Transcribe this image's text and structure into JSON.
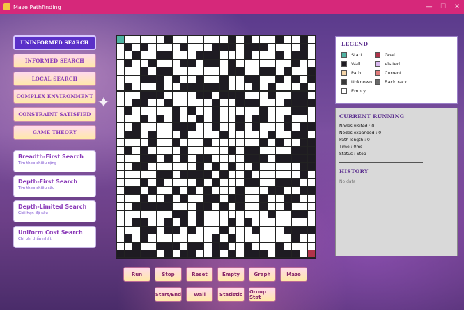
{
  "window": {
    "title": "Maze Pathfinding",
    "minimize": "—",
    "maximize": "☐",
    "close": "✕"
  },
  "categories": [
    {
      "label": "UNINFORMED SEARCH",
      "active": true
    },
    {
      "label": "INFORMED SEARCH",
      "active": false
    },
    {
      "label": "LOCAL SEARCH",
      "active": false
    },
    {
      "label": "COMPLEX ENVIRONMENT",
      "active": false
    },
    {
      "label": "CONSTRAINT SATISFIED",
      "active": false
    },
    {
      "label": "GAME THEORY",
      "active": false
    }
  ],
  "algorithms": [
    {
      "title": "Breadth-First Search",
      "subtitle": "Tìm theo chiều rộng"
    },
    {
      "title": "Depth-First Search",
      "subtitle": "Tìm theo chiều sâu"
    },
    {
      "title": "Depth-Limited Search",
      "subtitle": "Giới hạn độ sâu"
    },
    {
      "title": "Uniform Cost Search",
      "subtitle": "Chi phí thấp nhất"
    }
  ],
  "actions_row1": [
    "Run",
    "Stop",
    "Reset",
    "Empty",
    "Graph",
    "Maze"
  ],
  "actions_row2": [
    "Start/End",
    "Wall",
    "Statistic",
    "Group Stat"
  ],
  "legend": {
    "title": "LEGEND",
    "items": [
      {
        "label": "Start",
        "color": "#4fb3a3"
      },
      {
        "label": "Goal",
        "color": "#b0334a"
      },
      {
        "label": "Wall",
        "color": "#1e1b22"
      },
      {
        "label": "Visited",
        "color": "#d9b8f0"
      },
      {
        "label": "Path",
        "color": "#f5d5a8"
      },
      {
        "label": "Current",
        "color": "#e07a7a"
      },
      {
        "label": "Unknown",
        "color": "#3a3a3a"
      },
      {
        "label": "Backtrack",
        "color": "#6a6a6a"
      },
      {
        "label": "Empty",
        "color": "#ffffff"
      }
    ]
  },
  "running": {
    "title": "CURRENT RUNNING",
    "stats": [
      "Nodes visited : 0",
      "Nodes expanded : 0",
      "Path length : 0",
      "Time : 0ms",
      "Status : Stop"
    ],
    "history_title": "HISTORY",
    "history_empty": "No data"
  },
  "maze": {
    "rows": 28,
    "cols": 25,
    "colors": {
      "wall": "#1e1b22",
      "empty": "#ffffff",
      "start": "#4fb3a3",
      "goal": "#b0334a"
    },
    "cells": [
      "S.....#.......#.#...#..#.",
      ".#.#....#...###.###....#.",
      "..#..##...###...#...#.##.",
      ".#..#...##.##.#.......#..",
      "...#.##.......##..##.#..#",
      "...###.#..#..#..##..#.#.#",
      ".#...#..######...#.#...#.",
      "...###....##.###...#..##.",
      "..##..#.....#..###...####",
      ".#.....#.#..#.....#...##.",
      "...#.#.#..#.#..#.##..#...",
      "..#....###..#..#.#...#.##",
      ".##.#...#....#.....#..##.",
      "....#..#...#......#.#..##",
      ".#.#....#.....#.##....###",
      "...##.#.#.##....###.#####",
      "..##......#.#.#..#.....##",
      ".....##.####.#..#......#.",
      "...#.#....#.#...##..###..",
      ".##.#..#.#.#...#...##..##",
      "...#..#.#..##.##..#..##..",
      "..#####...##.#.#..#..#...",
      ".......##.#........#..##.",
      "..##..#.#.#...#.#........",
      "...##.##.#...#...#...####",
      ".#.#........#.#.......#..",
      "..#..###.##.##..#...#....",
      "#####.#.##..#.#.###.###.G"
    ]
  }
}
